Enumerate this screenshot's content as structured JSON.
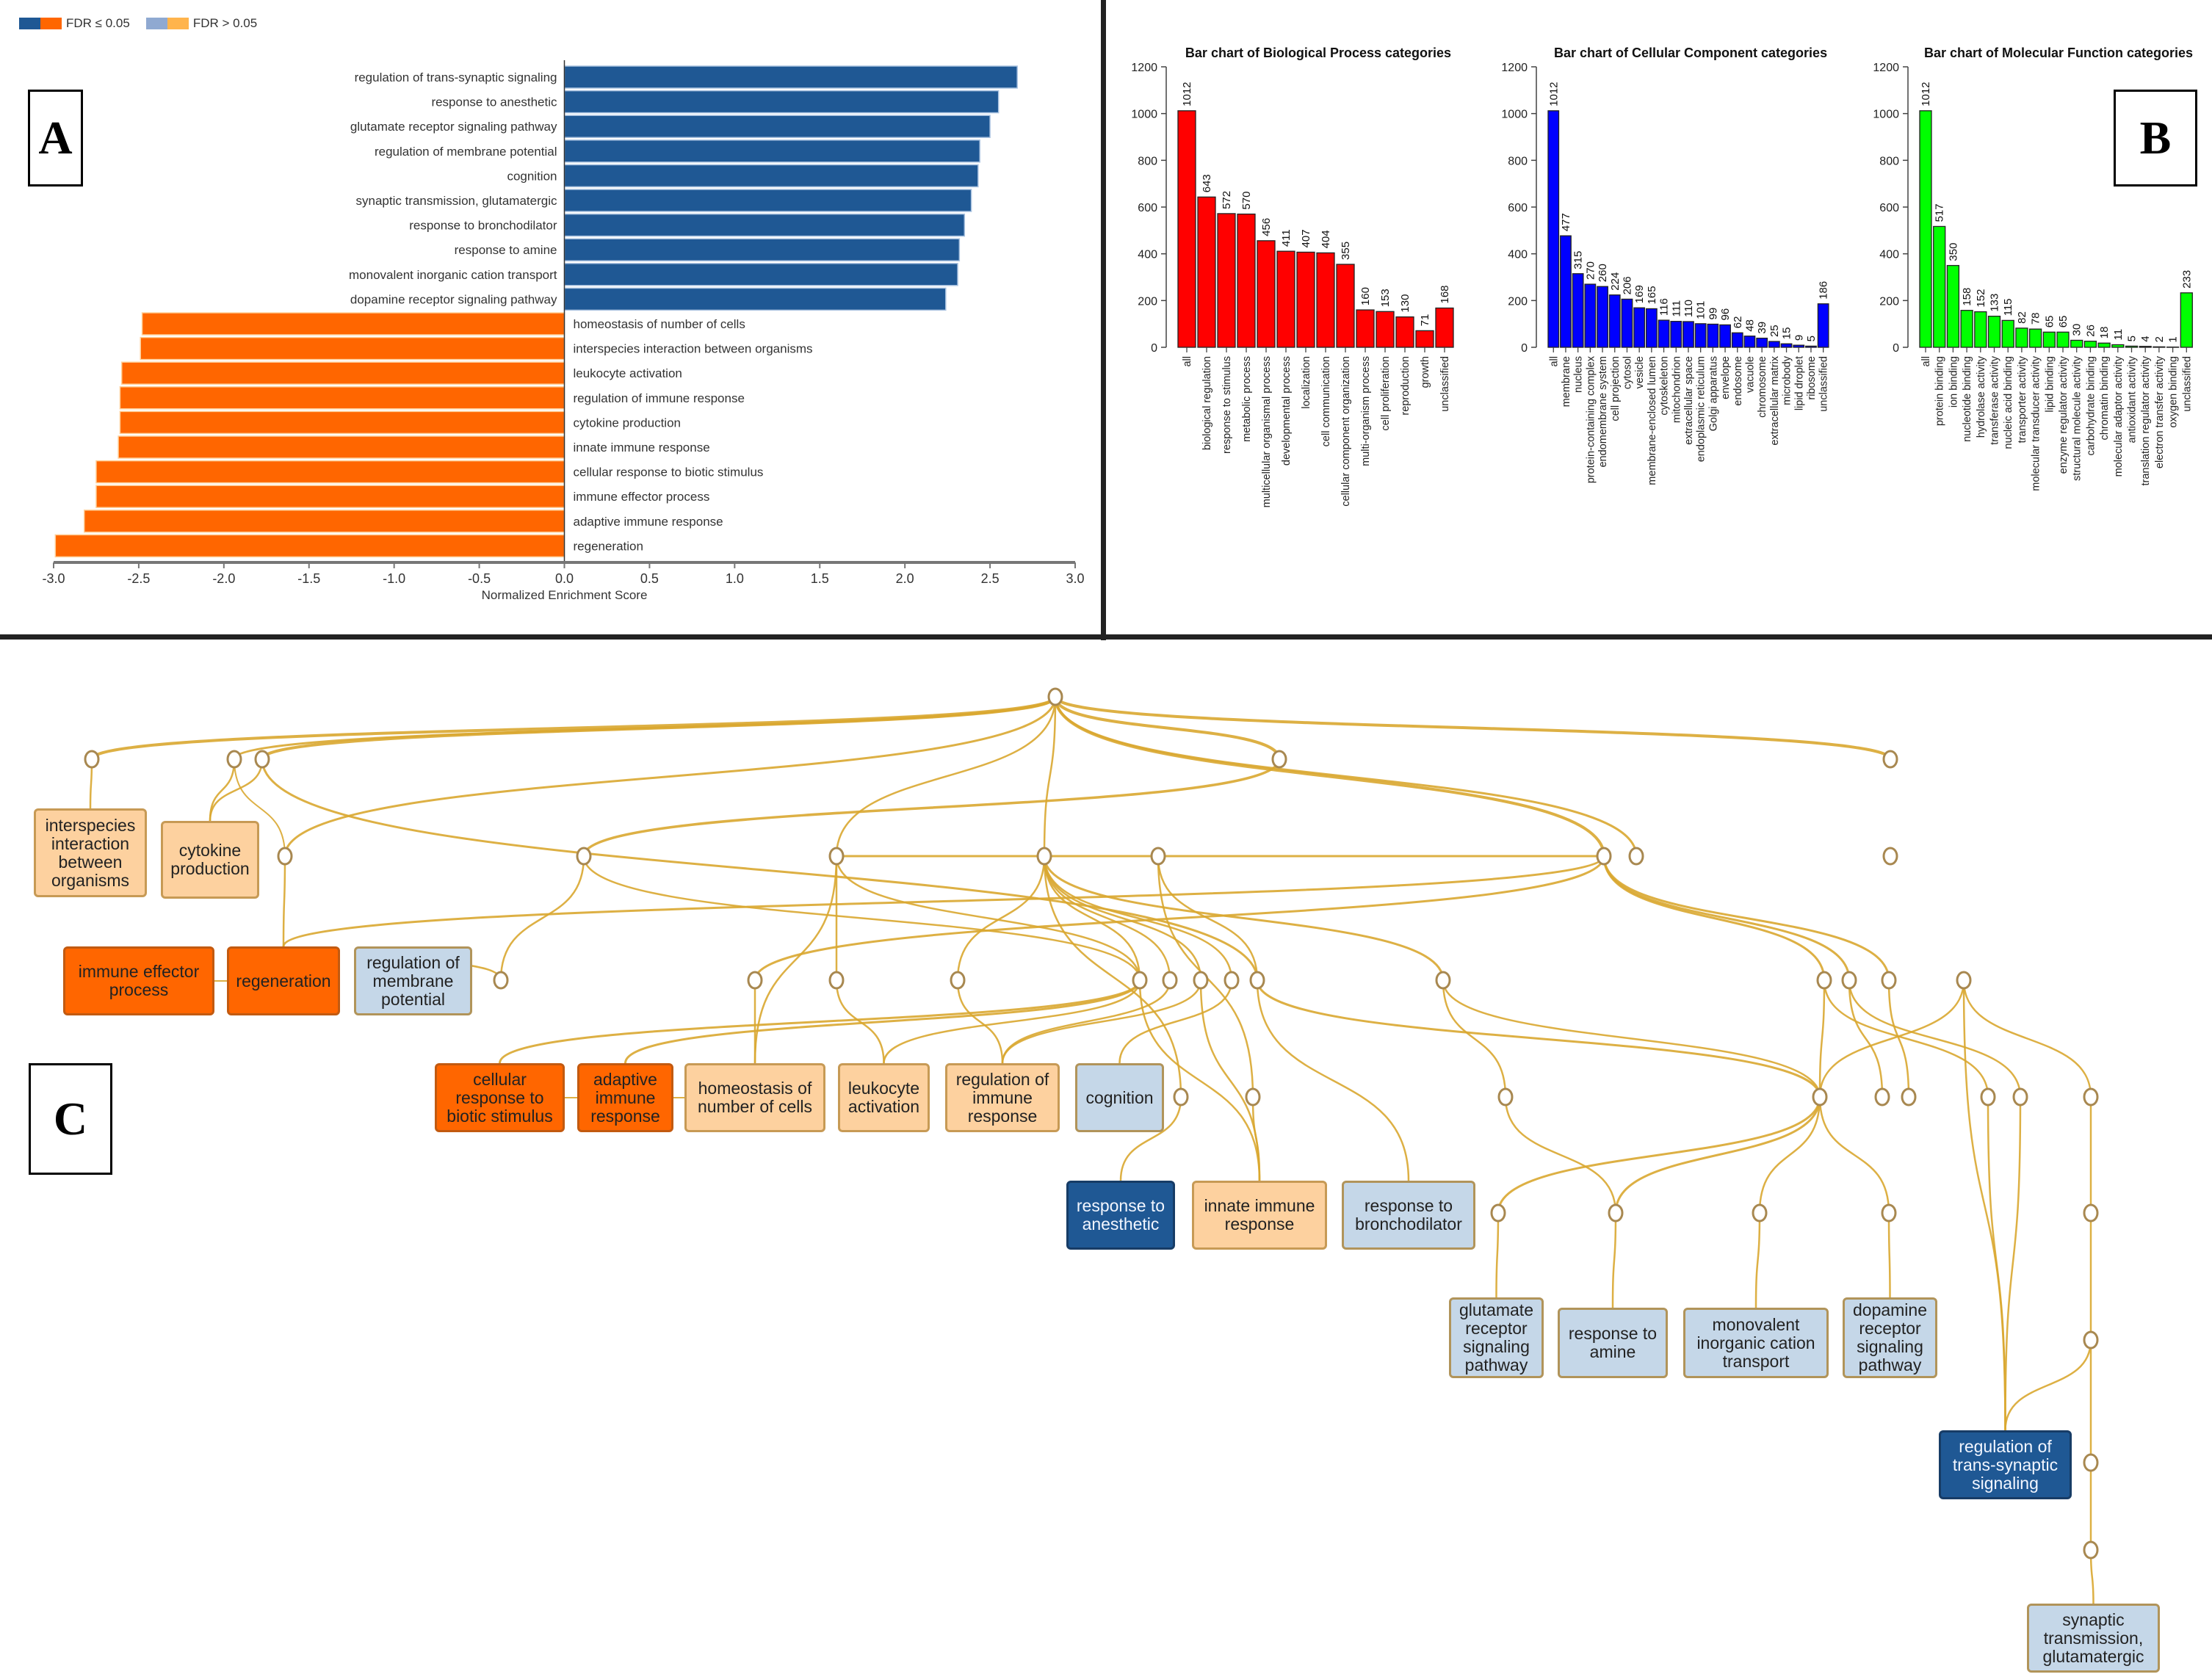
{
  "panels": {
    "a_label": "A",
    "b_label": "B",
    "c_label": "C"
  },
  "legend": {
    "items": [
      {
        "label": "FDR ≤ 0.05",
        "colors": [
          "#1f5894",
          "#ff6600"
        ]
      },
      {
        "label": "FDR > 0.05",
        "colors": [
          "#8fa9d1",
          "#ffb44c"
        ]
      }
    ]
  },
  "colors": {
    "positive_sig": "#1f5894",
    "negative_sig": "#ff6600",
    "positive_nonsig": "#c5d7e8",
    "negative_nonsig": "#fdd19f",
    "bp_bar": "#ff0000",
    "cc_bar": "#0000ff",
    "mf_bar": "#00ff00",
    "edge": "#d9a730",
    "node_outline": "#a88850"
  },
  "chart_data": [
    {
      "type": "bar",
      "orientation": "horizontal",
      "title": "",
      "xlabel": "Normalized Enrichment Score",
      "ylabel": "",
      "xlim": [
        -3.0,
        3.0
      ],
      "xticks": [
        "-3.0",
        "-2.5",
        "-2.0",
        "-1.5",
        "-1.0",
        "-0.5",
        "0.0",
        "0.5",
        "1.0",
        "1.5",
        "2.0",
        "2.5",
        "3.0"
      ],
      "categories": [
        "regulation of trans-synaptic signaling",
        "response to anesthetic",
        "glutamate receptor signaling pathway",
        "regulation of membrane potential",
        "cognition",
        "synaptic transmission, glutamatergic",
        "response to bronchodilator",
        "response to amine",
        "monovalent inorganic cation transport",
        "dopamine receptor signaling pathway",
        "homeostasis of number of cells",
        "interspecies interaction between organisms",
        "leukocyte activation",
        "regulation of immune response",
        "cytokine production",
        "innate immune response",
        "cellular response to biotic stimulus",
        "immune effector process",
        "adaptive immune response",
        "regeneration"
      ],
      "values": [
        2.66,
        2.55,
        2.5,
        2.44,
        2.43,
        2.39,
        2.35,
        2.32,
        2.31,
        2.24,
        -2.48,
        -2.49,
        -2.6,
        -2.61,
        -2.61,
        -2.62,
        -2.75,
        -2.75,
        -2.82,
        -2.99
      ],
      "legend": "top-left"
    },
    {
      "type": "bar",
      "title": "Bar chart of Biological Process categories",
      "xlabel": "",
      "ylabel": "",
      "ylim": [
        0,
        1200
      ],
      "yticks": [
        "0",
        "200",
        "400",
        "600",
        "800",
        "1000",
        "1200"
      ],
      "categories": [
        "all",
        "biological regulation",
        "response to stimulus",
        "metabolic process",
        "multicellular organismal process",
        "developmental process",
        "localization",
        "cell communication",
        "cellular component organization",
        "multi-organism process",
        "cell proliferation",
        "reproduction",
        "growth",
        "unclassified"
      ],
      "values": [
        1012,
        643,
        572,
        570,
        456,
        411,
        407,
        404,
        355,
        160,
        153,
        130,
        71,
        168
      ]
    },
    {
      "type": "bar",
      "title": "Bar chart of Cellular Component categories",
      "xlabel": "",
      "ylabel": "",
      "ylim": [
        0,
        1200
      ],
      "yticks": [
        "0",
        "200",
        "400",
        "600",
        "800",
        "1000",
        "1200"
      ],
      "categories": [
        "all",
        "membrane",
        "nucleus",
        "protein-containing complex",
        "endomembrane system",
        "cell projection",
        "cytosol",
        "vesicle",
        "membrane-enclosed lumen",
        "cytoskeleton",
        "mitochondrion",
        "extracellular space",
        "endoplasmic reticulum",
        "Golgi apparatus",
        "envelope",
        "endosome",
        "vacuole",
        "chromosome",
        "extracellular matrix",
        "microbody",
        "lipid droplet",
        "ribosome",
        "unclassified"
      ],
      "values": [
        1012,
        477,
        315,
        270,
        260,
        224,
        206,
        169,
        165,
        116,
        111,
        110,
        101,
        99,
        96,
        62,
        48,
        39,
        25,
        15,
        9,
        5,
        186
      ]
    },
    {
      "type": "bar",
      "title": "Bar chart of Molecular Function categories",
      "xlabel": "",
      "ylabel": "",
      "ylim": [
        0,
        1200
      ],
      "yticks": [
        "0",
        "200",
        "400",
        "600",
        "800",
        "1000",
        "1200"
      ],
      "categories": [
        "all",
        "protein binding",
        "ion binding",
        "nucleotide binding",
        "hydrolase activity",
        "transferase activity",
        "nucleic acid binding",
        "transporter activity",
        "molecular transducer activity",
        "lipid binding",
        "enzyme regulator activity",
        "structural molecule activity",
        "carbohydrate binding",
        "chromatin binding",
        "molecular adaptor activity",
        "antioxidant activity",
        "translation regulator activity",
        "electron transfer activity",
        "oxygen binding",
        "unclassified"
      ],
      "values": [
        1012,
        517,
        350,
        158,
        152,
        133,
        115,
        82,
        78,
        65,
        65,
        30,
        26,
        18,
        11,
        5,
        4,
        2,
        1,
        233
      ]
    }
  ],
  "network": {
    "terms": [
      {
        "id": "interspecies",
        "label": "interspecies\ninteraction\nbetween\norganisms",
        "status": "nonsig-down"
      },
      {
        "id": "cytokine",
        "label": "cytokine\nproduction",
        "status": "nonsig-down"
      },
      {
        "id": "immune_effector",
        "label": "immune effector\nprocess",
        "status": "sig-down"
      },
      {
        "id": "regeneration",
        "label": "regeneration",
        "status": "sig-down"
      },
      {
        "id": "reg_membrane",
        "label": "regulation of\nmembrane\npotential",
        "status": "nonsig-up"
      },
      {
        "id": "cellular_response",
        "label": "cellular\nresponse to\nbiotic stimulus",
        "status": "sig-down"
      },
      {
        "id": "adaptive",
        "label": "adaptive\nimmune\nresponse",
        "status": "sig-down"
      },
      {
        "id": "homeostasis",
        "label": "homeostasis of\nnumber of cells",
        "status": "nonsig-down"
      },
      {
        "id": "leukocyte",
        "label": "leukocyte\nactivation",
        "status": "nonsig-down"
      },
      {
        "id": "reg_immune",
        "label": "regulation of\nimmune\nresponse",
        "status": "nonsig-down"
      },
      {
        "id": "cognition",
        "label": "cognition",
        "status": "nonsig-up"
      },
      {
        "id": "anesthetic",
        "label": "response to\nanesthetic",
        "status": "sig-up"
      },
      {
        "id": "innate",
        "label": "innate immune\nresponse",
        "status": "nonsig-down"
      },
      {
        "id": "bronchodilator",
        "label": "response to\nbronchodilator",
        "status": "nonsig-up"
      },
      {
        "id": "glutamate_receptor",
        "label": "glutamate\nreceptor\nsignaling\npathway",
        "status": "nonsig-up"
      },
      {
        "id": "amine",
        "label": "response to\namine",
        "status": "nonsig-up"
      },
      {
        "id": "monovalent",
        "label": "monovalent\ninorganic cation\ntransport",
        "status": "nonsig-up"
      },
      {
        "id": "dopamine",
        "label": "dopamine\nreceptor\nsignaling\npathway",
        "status": "nonsig-up"
      },
      {
        "id": "trans_synaptic",
        "label": "regulation of\ntrans-synaptic\nsignaling",
        "status": "sig-up"
      },
      {
        "id": "synaptic_glut",
        "label": "synaptic\ntransmission,\nglutamatergic",
        "status": "nonsig-up"
      }
    ]
  }
}
